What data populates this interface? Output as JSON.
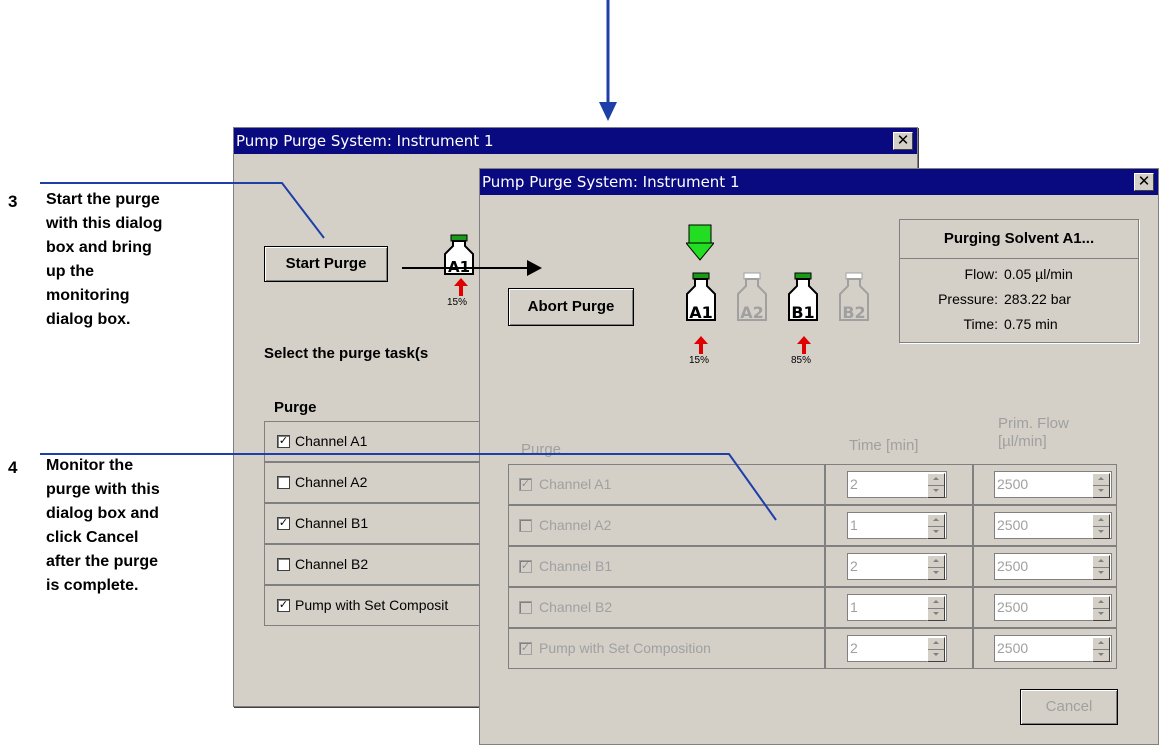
{
  "annotations": {
    "step3_number": "3",
    "step3_lines": [
      "Start the purge",
      "with this dialog",
      "box and bring",
      "up the",
      "monitoring",
      "dialog box."
    ],
    "step4_number": "4",
    "step4_lines": [
      "Monitor the",
      "purge with this",
      "dialog box and",
      "click Cancel",
      "after the purge",
      "is complete."
    ]
  },
  "back_dialog": {
    "title": "Pump Purge System: Instrument 1",
    "start_button": "Start Purge",
    "bottle_label": "A1",
    "bottle_pct": "15%",
    "select_text": "Select the purge task(s",
    "purge_header": "Purge",
    "rows": [
      {
        "label": "Channel A1",
        "checked": true
      },
      {
        "label": "Channel A2",
        "checked": false
      },
      {
        "label": "Channel B1",
        "checked": true
      },
      {
        "label": "Channel B2",
        "checked": false
      },
      {
        "label": "Pump with Set Composit",
        "checked": true
      }
    ]
  },
  "front_dialog": {
    "title": "Pump Purge System: Instrument 1",
    "abort_button": "Abort Purge",
    "bottles": [
      {
        "label": "A1",
        "active": true,
        "pct": "15%"
      },
      {
        "label": "A2",
        "active": false,
        "pct": ""
      },
      {
        "label": "B1",
        "active": true,
        "pct": "85%"
      },
      {
        "label": "B2",
        "active": false,
        "pct": ""
      }
    ],
    "status": {
      "heading": "Purging Solvent A1...",
      "flow_label": "Flow:",
      "flow_value": "0.05 µl/min",
      "pressure_label": "Pressure:",
      "pressure_value": "283.22 bar",
      "time_label": "Time:",
      "time_value": "0.75 min"
    },
    "col_purge": "Purge",
    "col_time": "Time [min]",
    "col_flow_1": "Prim. Flow",
    "col_flow_2": "[µl/min]",
    "rows": [
      {
        "label": "Channel A1",
        "checked": true,
        "time": "2",
        "flow": "2500"
      },
      {
        "label": "Channel A2",
        "checked": false,
        "time": "1",
        "flow": "2500"
      },
      {
        "label": "Channel B1",
        "checked": true,
        "time": "2",
        "flow": "2500"
      },
      {
        "label": "Channel B2",
        "checked": false,
        "time": "1",
        "flow": "2500"
      },
      {
        "label": "Pump with Set Composition",
        "checked": true,
        "time": "2",
        "flow": "2500"
      }
    ],
    "cancel_button": "Cancel"
  },
  "colors": {
    "titlebar": "#0a0a80",
    "callout_line": "#1f3fa8",
    "arrow_red": "#e00000",
    "valve_green": "#22dd22"
  }
}
